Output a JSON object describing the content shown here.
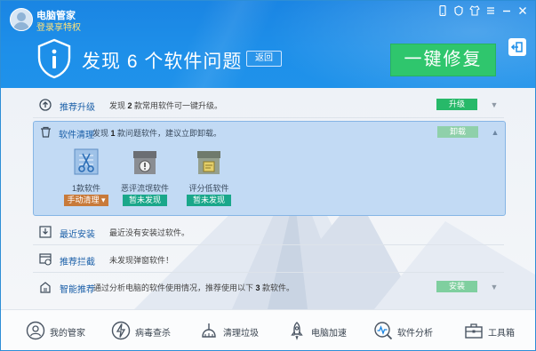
{
  "app": {
    "title": "电脑管家",
    "login_link": "登录享特权"
  },
  "window_controls": [
    "mobile-icon",
    "skin-icon",
    "shirt-icon",
    "menu-icon",
    "minimize-icon",
    "close-icon"
  ],
  "banner": {
    "headline": "发现 6 个软件问题",
    "back_label": "返回",
    "fix_label": "一键修复"
  },
  "rows": {
    "upgrade": {
      "name": "推荐升级",
      "desc_pre": "发现 ",
      "desc_num": "2",
      "desc_post": " 款常用软件可一键升级。",
      "action": "升级"
    },
    "cleanup": {
      "name": "软件清理",
      "desc_pre": "发现 ",
      "desc_num": "1",
      "desc_post": " 款问题软件，建议立即卸载。",
      "action": "卸载",
      "tiles": [
        {
          "label": "1款软件",
          "tag": "手动清理 ▾"
        },
        {
          "label": "恶评流氓软件",
          "tag": "暂未发现"
        },
        {
          "label": "评分低软件",
          "tag": "暂未发现"
        }
      ]
    },
    "recent": {
      "name": "最近安装",
      "desc": "最近没有安装过软件。"
    },
    "block": {
      "name": "推荐拦截",
      "desc": "未发现弹窗软件！"
    },
    "smart": {
      "name": "智能推荐",
      "desc_pre": "通过分析电脑的软件使用情况，推荐使用以下 ",
      "desc_num": "3",
      "desc_post": " 款软件。",
      "action": "安装"
    }
  },
  "footer": [
    {
      "label": "我的管家",
      "icon": "home-icon"
    },
    {
      "label": "病毒查杀",
      "icon": "virus-scan-icon"
    },
    {
      "label": "清理垃圾",
      "icon": "broom-icon"
    },
    {
      "label": "电脑加速",
      "icon": "rocket-icon"
    },
    {
      "label": "软件分析",
      "icon": "software-analysis-icon"
    },
    {
      "label": "工具箱",
      "icon": "toolbox-icon"
    }
  ],
  "colors": {
    "header_blue": "#1e8fe9",
    "action_green": "#27b969",
    "link_blue": "#1a5fa8",
    "tag_orange": "#c87a3a",
    "tag_teal": "#1aa78a"
  }
}
